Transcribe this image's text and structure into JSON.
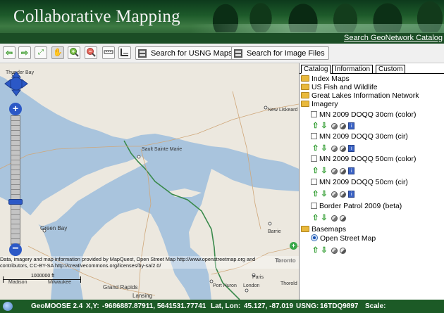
{
  "header": {
    "title": "Collaborative Mapping",
    "search_link": "Search GeoNetwork Catalog"
  },
  "toolbar": {
    "buttons": [
      "arrow-left-icon",
      "arrow-right-icon",
      "full-extent-icon",
      "pan-hand-icon",
      "zoom-in-icon",
      "zoom-out-icon",
      "measure-length-icon",
      "measure-area-icon"
    ],
    "search_usng": "Search for USNG Maps",
    "search_images": "Search for Image Files"
  },
  "map": {
    "labels": [
      "Thunder Bay",
      "New Liskeard",
      "Sault Sainte Marie",
      "Green Bay",
      "Barrie",
      "Toronto",
      "Port Huron",
      "London",
      "Paris",
      "Grand Rapids",
      "Lansing",
      "Milwaukee",
      "Madison",
      "Thorold"
    ],
    "attribution_line1": "Data, imagery and map information provided by MapQuest, Open Street Map http://www.openstreetmap.org and",
    "attribution_line2": "contributors, CC-BY-SA http://creativecommons.org/licenses/by-sa/2.0/",
    "scale_label": "1000000 ft"
  },
  "panel": {
    "tabs": [
      "Catalog",
      "Information",
      "Custom"
    ],
    "folders": {
      "index_maps": "Index Maps",
      "fish_wildlife": "US Fish and Wildlife",
      "great_lakes": "Great Lakes Information Network",
      "imagery": "Imagery",
      "basemaps": "Basemaps"
    },
    "imagery_layers": [
      "MN 2009 DOQQ 30cm (color)",
      "MN 2009 DOQQ 30cm (cir)",
      "MN 2009 DOQQ 50cm (color)",
      "MN 2009 DOQQ 50cm (cir)",
      "Border Patrol 2009 (beta)"
    ],
    "basemap_layers": [
      "Open Street Map"
    ]
  },
  "status": {
    "app_version": "GeoMOOSE 2.4",
    "xy_label": "X,Y:",
    "xy_value": "-9686887.87911, 5641531.77741",
    "latlon_label": "Lat, Lon:",
    "latlon_value": "45.127, -87.019",
    "usng_label": "USNG:",
    "usng_value": "16TDQ9897",
    "scale_label": "Scale:"
  },
  "colors": {
    "header_green": "#1b4d25",
    "status_green": "#1c5a26",
    "water": "#a9c4dd",
    "land": "#ece8df",
    "border_green": "#3a8a4c"
  }
}
